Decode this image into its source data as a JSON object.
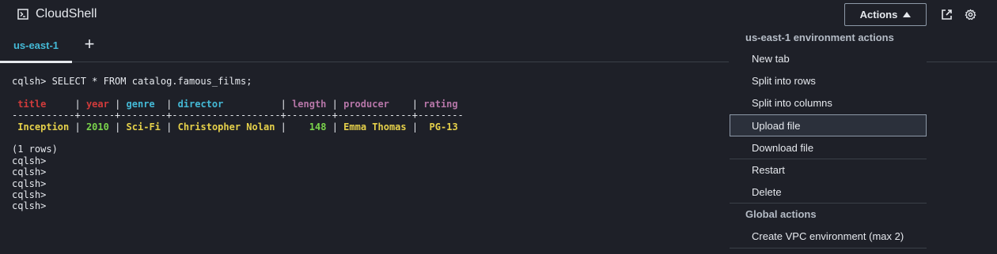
{
  "header": {
    "title": "CloudShell",
    "actions_label": "Actions",
    "icons": [
      "terminal-icon",
      "external-link-icon",
      "gear-icon"
    ]
  },
  "tabs": [
    {
      "label": "us-east-1",
      "active": true
    }
  ],
  "add_tab_label": "+",
  "terminal": {
    "command_line": "cqlsh> SELECT * FROM catalog.famous_films;",
    "columns": [
      "title",
      "year",
      "genre",
      "director",
      "length",
      "producer",
      "rating"
    ],
    "separator": "-----------+------+--------+-------------------+--------+-------------+--------",
    "row": {
      "title": "Inception",
      "year": "2010",
      "genre": "Sci-Fi",
      "director": "Christopher Nolan",
      "length": "148",
      "producer": "Emma Thomas",
      "rating": "PG-13"
    },
    "row_count": "(1 rows)",
    "prompts": [
      "cqlsh>",
      "cqlsh>",
      "cqlsh>",
      "cqlsh>",
      "cqlsh>"
    ]
  },
  "menu": {
    "section1_heading": "us-east-1 environment actions",
    "section1_items": [
      "New tab",
      "Split into rows",
      "Split into columns",
      "Upload file",
      "Download file"
    ],
    "section2_items": [
      "Restart",
      "Delete"
    ],
    "section3_heading": "Global actions",
    "section3_items": [
      "Create VPC environment (max 2)"
    ],
    "selected_item": "Upload file"
  },
  "colors": {
    "background": "#1e2028",
    "tab_accent": "#44b9d6",
    "header_red": "#d13b3b",
    "header_magenta": "#b676a8",
    "value_yellow": "#e5d04a",
    "value_green": "#7ad34b"
  }
}
